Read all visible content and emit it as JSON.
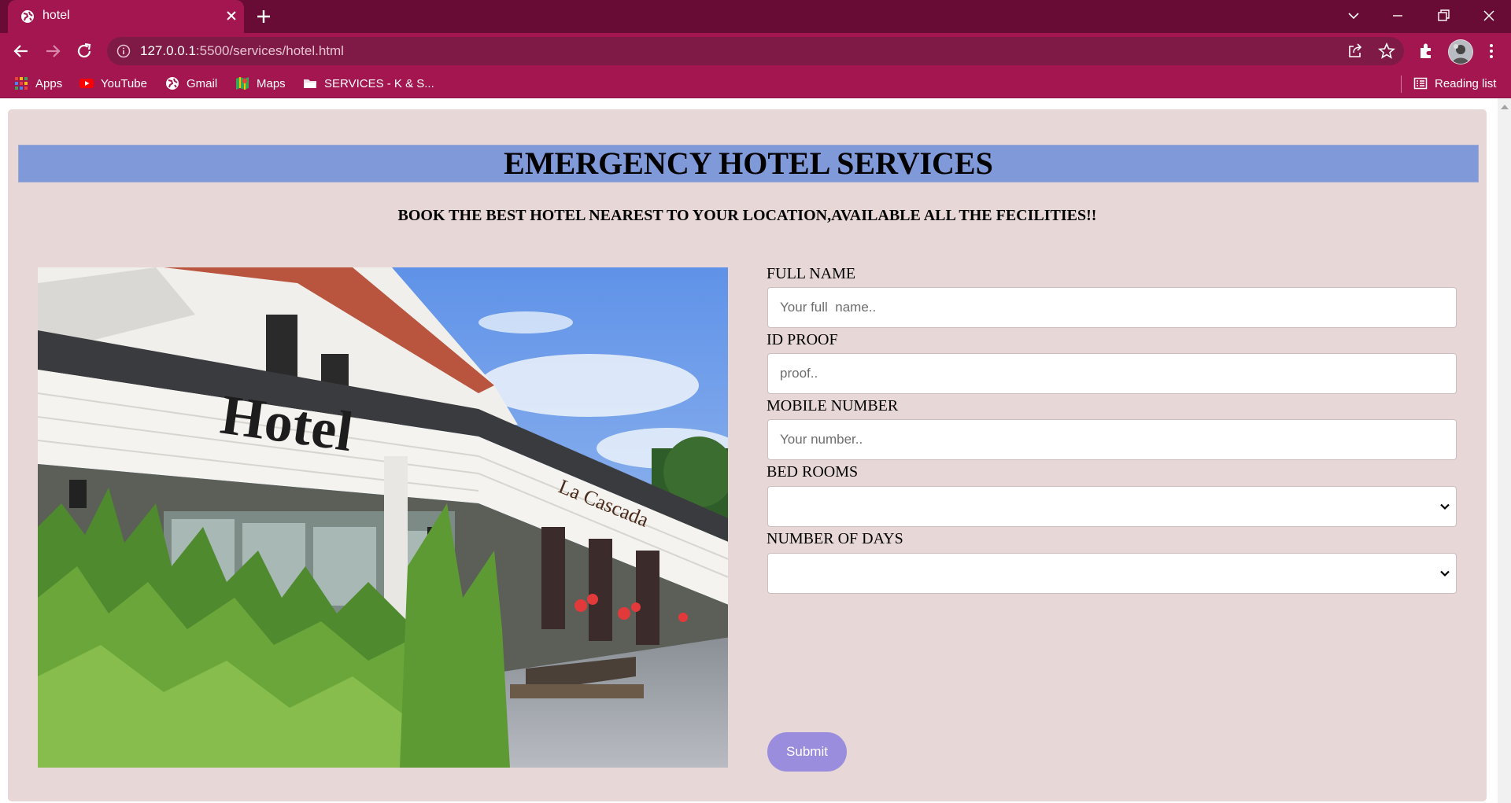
{
  "browser": {
    "tab_title": "hotel",
    "url_host": "127.0.0.1",
    "url_path": ":5500/services/hotel.html",
    "bookmarks": [
      {
        "label": "Apps",
        "icon": "apps-grid-icon"
      },
      {
        "label": "YouTube",
        "icon": "youtube-icon"
      },
      {
        "label": "Gmail",
        "icon": "globe-icon"
      },
      {
        "label": "Maps",
        "icon": "maps-icon"
      },
      {
        "label": "SERVICES - K & S...",
        "icon": "folder-icon"
      }
    ],
    "reading_list": "Reading list"
  },
  "page": {
    "title": "EMERGENCY HOTEL SERVICES",
    "subtitle": "BOOK THE BEST HOTEL NEAREST TO YOUR LOCATION,AVAILABLE ALL THE FECILITIES!!",
    "photo": {
      "sign_text": "Hotel",
      "facade_text": "La Cascada"
    },
    "form": {
      "full_name_label": "FULL NAME",
      "full_name_placeholder": "Your full  name..",
      "id_proof_label": "ID PROOF",
      "id_proof_placeholder": "proof..",
      "mobile_label": "MOBILE NUMBER",
      "mobile_placeholder": "Your number..",
      "bedrooms_label": "BED ROOMS",
      "days_label": "NUMBER OF DAYS",
      "submit_label": "Submit"
    }
  },
  "colors": {
    "tab_bar": "#680c35",
    "toolbar": "#a3164f",
    "page_card": "#e7d7d7",
    "banner": "#7f99d9",
    "submit": "#9b8ddd"
  }
}
